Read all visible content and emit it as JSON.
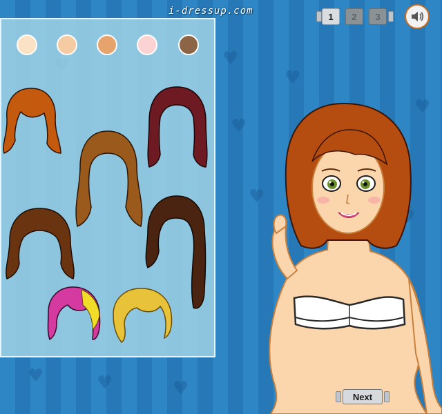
{
  "header": {
    "site_label": "i-dressup.com"
  },
  "skin_tones": [
    {
      "name": "porcelain",
      "color": "#fbe2c4"
    },
    {
      "name": "light",
      "color": "#f4cba2"
    },
    {
      "name": "tan",
      "color": "#e6a46c"
    },
    {
      "name": "pink",
      "color": "#fcd3d3"
    },
    {
      "name": "brown",
      "color": "#8c6446"
    }
  ],
  "pager": {
    "pages": [
      "1",
      "2",
      "3"
    ],
    "active_index": 0
  },
  "sound": {
    "icon": "speaker-icon"
  },
  "hairstyles": [
    {
      "name": "auburn-flip",
      "color": "#c45a0e"
    },
    {
      "name": "burgundy-straight",
      "color": "#6e1a22"
    },
    {
      "name": "golden-brown-long",
      "color": "#9a5a1c"
    },
    {
      "name": "dark-brown-shag",
      "color": "#6a3410"
    },
    {
      "name": "brunette-wavy",
      "color": "#4a2410"
    },
    {
      "name": "pink-yellow-pixie",
      "color": "#d43aa0"
    },
    {
      "name": "blonde-pixie",
      "color": "#e8c238"
    }
  ],
  "model": {
    "hair_color": "#b54c10",
    "skin_color": "#fbd6ad",
    "eye_color": "#6b8f2a",
    "top_color": "#ffffff"
  },
  "footer": {
    "next_label": "Next"
  }
}
